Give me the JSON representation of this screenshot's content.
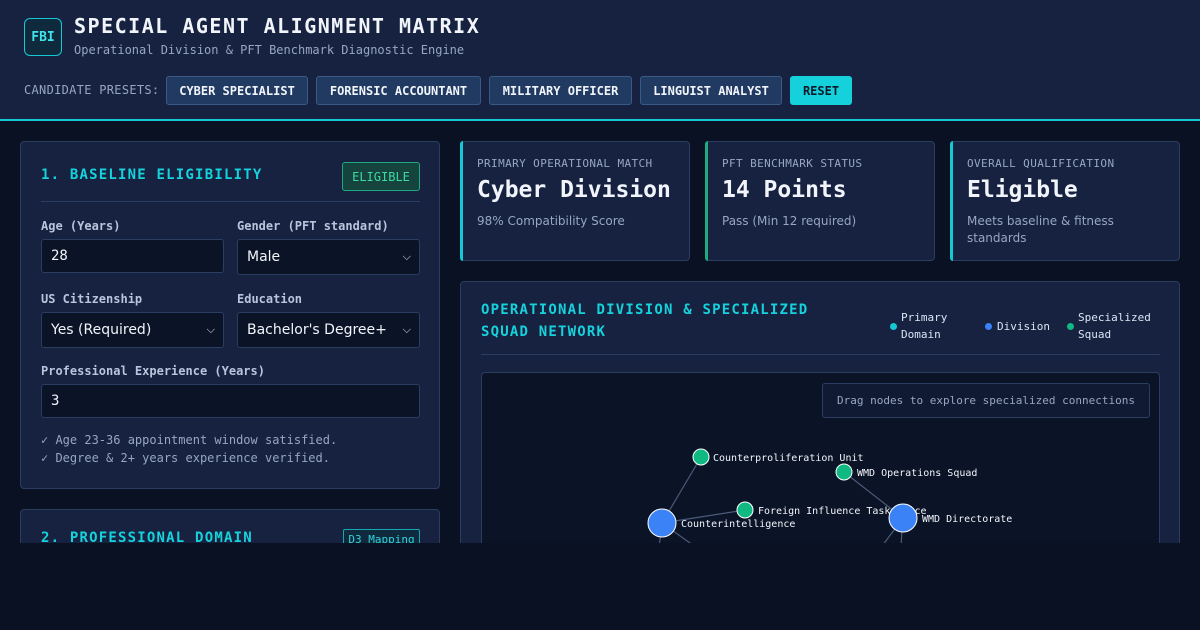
{
  "header": {
    "logo": "FBI",
    "title": "SPECIAL AGENT ALIGNMENT MATRIX",
    "subtitle": "Operational Division & PFT Benchmark Diagnostic Engine",
    "presets_label": "CANDIDATE PRESETS:",
    "presets": [
      "CYBER SPECIALIST",
      "FORENSIC ACCOUNTANT",
      "MILITARY OFFICER",
      "LINGUIST ANALYST"
    ],
    "reset_label": "RESET"
  },
  "eligibility": {
    "title": "1. BASELINE ELIGIBILITY",
    "badge": "ELIGIBLE",
    "age_label": "Age (Years)",
    "age_value": "28",
    "gender_label": "Gender (PFT standard)",
    "gender_value": "Male",
    "citizenship_label": "US Citizenship",
    "citizenship_value": "Yes (Required)",
    "education_label": "Education",
    "education_value": "Bachelor's Degree+",
    "experience_label": "Professional Experience (Years)",
    "experience_value": "3",
    "checks": [
      "✓ Age 23-36 appointment window satisfied.",
      "✓ Degree & 2+ years experience verified."
    ]
  },
  "domain": {
    "title": "2. PROFESSIONAL DOMAIN",
    "badge": "D3 Mapping"
  },
  "stats": [
    {
      "label": "PRIMARY OPERATIONAL MATCH",
      "value": "Cyber Division",
      "note": "98% Compatibility Score",
      "accent": "#14c8d4"
    },
    {
      "label": "PFT BENCHMARK STATUS",
      "value": "14 Points",
      "note": "Pass (Min 12 required)",
      "accent": "#1faa80"
    },
    {
      "label": "OVERALL QUALIFICATION",
      "value": "Eligible",
      "note": "Meets baseline & fitness standards",
      "accent": "#14c8d4"
    }
  ],
  "network": {
    "title_line1": "OPERATIONAL DIVISION & SPECIALIZED",
    "title_line2": "SQUAD NETWORK",
    "legend": [
      {
        "label_line1": "Primary",
        "label_line2": "Domain",
        "color": "#14c8d4"
      },
      {
        "label_line1": "Division",
        "label_line2": "",
        "color": "#3b82f6"
      },
      {
        "label_line1": "Specialized",
        "label_line2": "Squad",
        "color": "#10b981"
      }
    ],
    "hint": "Drag nodes to explore specialized connections",
    "nodes": [
      {
        "id": "counterprolif",
        "label": "Counterproliferation Unit",
        "type": "squad"
      },
      {
        "id": "wmdops",
        "label": "WMD Operations Squad",
        "type": "squad"
      },
      {
        "id": "foreign",
        "label": "Foreign Influence Task Force",
        "type": "squad"
      },
      {
        "id": "ci",
        "label": "Counterintelligence",
        "type": "division"
      },
      {
        "id": "wmd",
        "label": "WMD Directorate",
        "type": "division"
      }
    ],
    "colors": {
      "squad": "#10b981",
      "division": "#3b82f6",
      "edge": "#4a5a78"
    }
  }
}
